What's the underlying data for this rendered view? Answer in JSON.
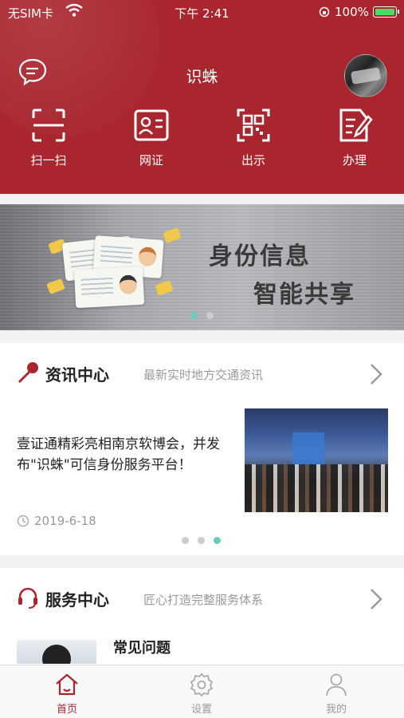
{
  "status_bar": {
    "carrier": "无SIM卡",
    "time": "下午 2:41",
    "battery": "100%"
  },
  "header": {
    "title": "识蛛",
    "message_icon": "chat-bubble-icon",
    "avatar": "user-avatar"
  },
  "actions": [
    {
      "label": "扫一扫",
      "icon": "scan-icon"
    },
    {
      "label": "网证",
      "icon": "id-card-icon"
    },
    {
      "label": "出示",
      "icon": "qr-code-icon"
    },
    {
      "label": "办理",
      "icon": "edit-document-icon"
    }
  ],
  "banner": {
    "line1": "身份信息",
    "line2": "智能共享",
    "page_count": 2,
    "active_page": 1
  },
  "news": {
    "title": "资讯中心",
    "subtitle": "最新实时地方交通资讯",
    "item_title": "壹证通精彩亮相南京软博会，并发布\"识蛛\"可信身份服务平台！",
    "date": "2019-6-18",
    "page_count": 3,
    "active_page": 3
  },
  "service": {
    "title": "服务中心",
    "subtitle": "匠心打造完整服务体系",
    "faq_title": "常见问题"
  },
  "tabbar": [
    {
      "label": "首页",
      "icon": "home-icon",
      "active": true
    },
    {
      "label": "设置",
      "icon": "gear-icon",
      "active": false
    },
    {
      "label": "我的",
      "icon": "person-icon",
      "active": false
    }
  ],
  "colors": {
    "brand_red": "#a9262f",
    "indicator_active": "#6dc8bd"
  }
}
